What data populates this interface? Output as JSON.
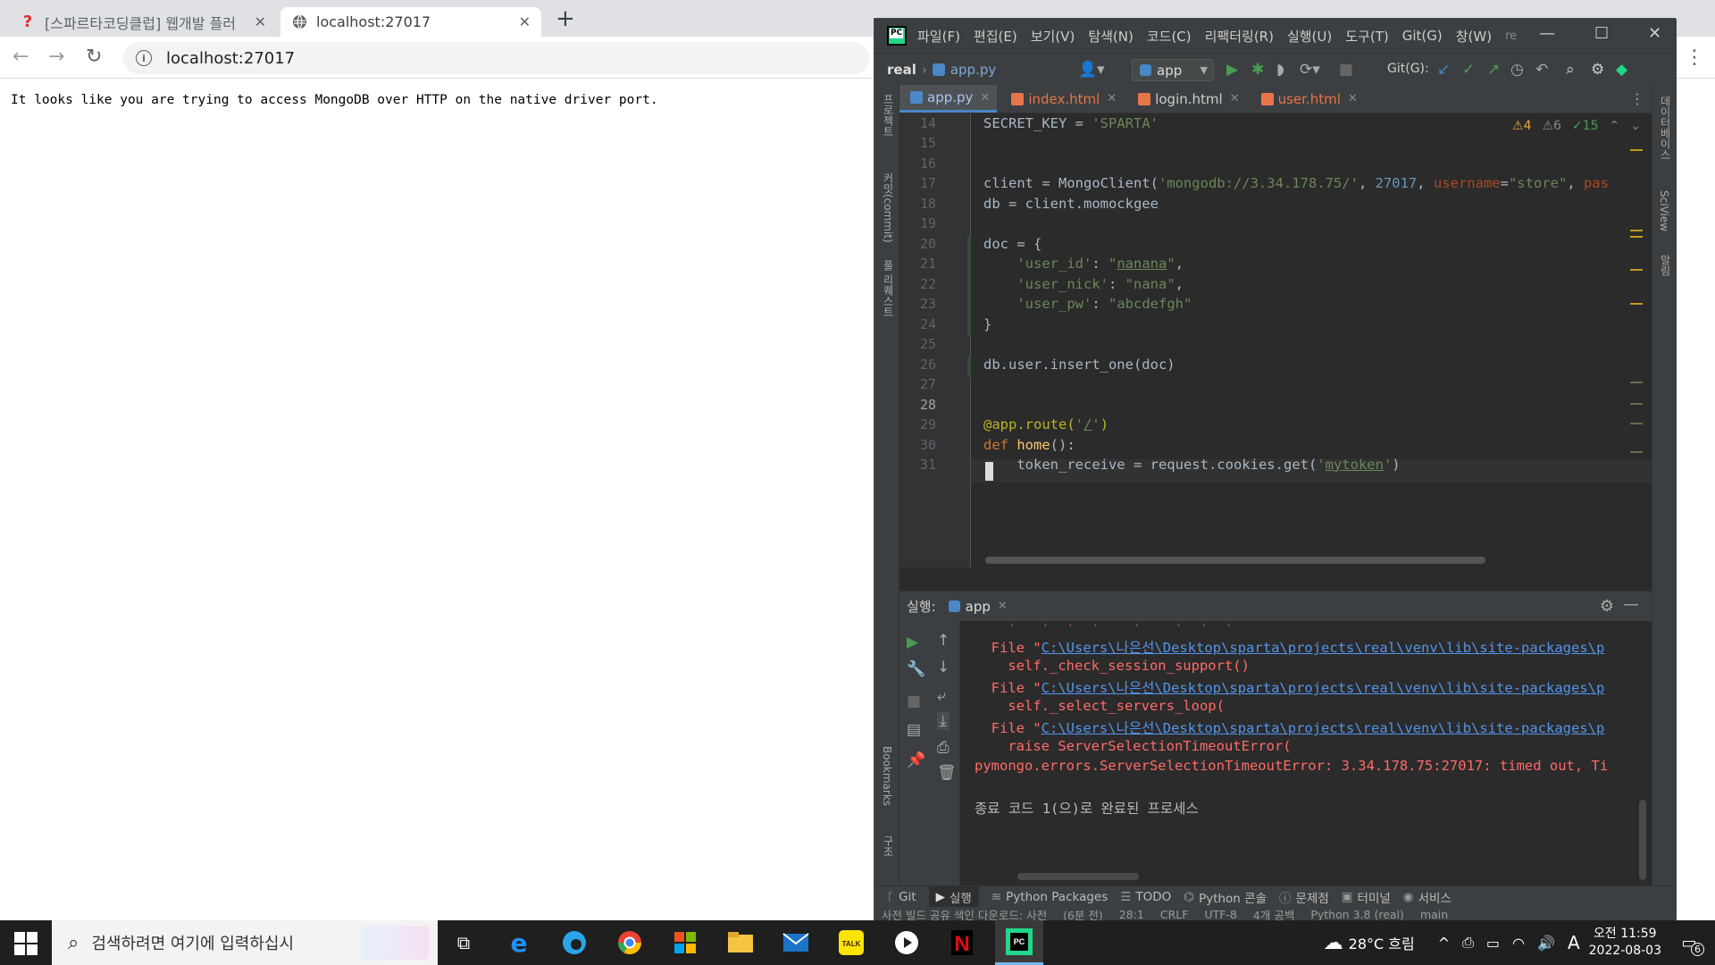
{
  "browser": {
    "tabs": [
      {
        "title": "[스파르타코딩클럽] 웹개발 플러",
        "active": false
      },
      {
        "title": "localhost:27017",
        "active": true
      }
    ],
    "address": "localhost:27017",
    "page_text": "It looks like you are trying to access MongoDB over HTTP on the native driver port."
  },
  "ide": {
    "menu": [
      "파일(F)",
      "편집(E)",
      "보기(V)",
      "탐색(N)",
      "코드(C)",
      "리팩터링(R)",
      "실행(U)",
      "도구(T)",
      "Git(G)",
      "창(W)",
      "re"
    ],
    "project": "real",
    "crumb_file": "app.py",
    "run_config": "app",
    "git_label": "Git(G):",
    "editor_tabs": [
      {
        "name": "app.py",
        "active": true,
        "color": "#4a88c7"
      },
      {
        "name": "index.html",
        "active": false,
        "color": "#e8754a"
      },
      {
        "name": "login.html",
        "active": false,
        "color": "#e8754a"
      },
      {
        "name": "user.html",
        "active": false,
        "color": "#e8754a"
      }
    ],
    "inspections": {
      "warnings": "4",
      "weak_warnings": "6",
      "ok": "15"
    },
    "line_numbers": [
      "14",
      "15",
      "16",
      "17",
      "18",
      "19",
      "20",
      "21",
      "22",
      "23",
      "24",
      "25",
      "26",
      "27",
      "28",
      "29",
      "30",
      "31"
    ],
    "current_line": "28",
    "left_panels": [
      "프로젝트",
      "커밋(commit)",
      "풀 리퀘스트",
      "Bookmarks",
      "구조"
    ],
    "right_panels": [
      "데이터베이스",
      "SciView",
      "알림"
    ],
    "run_panel": {
      "label": "실행:",
      "tab": "app",
      "lines": [
        {
          "kind": "file",
          "prefix": "  File \"",
          "link": "C:\\Users\\나은선\\Desktop\\sparta\\projects\\real\\venv\\lib\\site-packages\\p"
        },
        {
          "kind": "err",
          "text": "    self._check_session_support()"
        },
        {
          "kind": "file",
          "prefix": "  File \"",
          "link": "C:\\Users\\나은선\\Desktop\\sparta\\projects\\real\\venv\\lib\\site-packages\\p"
        },
        {
          "kind": "err",
          "text": "    self._select_servers_loop("
        },
        {
          "kind": "file",
          "prefix": "  File \"",
          "link": "C:\\Users\\나은선\\Desktop\\sparta\\projects\\real\\venv\\lib\\site-packages\\p"
        },
        {
          "kind": "err",
          "text": "    raise ServerSelectionTimeoutError("
        },
        {
          "kind": "err",
          "text": "pymongo.errors.ServerSelectionTimeoutError: 3.34.178.75:27017: timed out, Ti"
        },
        {
          "kind": "blank",
          "text": ""
        },
        {
          "kind": "gray",
          "text": "종료 코드 1(으)로 완료된 프로세스"
        }
      ]
    },
    "bottom_tabs": [
      "Git",
      "실행",
      "Python Packages",
      "TODO",
      "Python 콘솔",
      "문제점",
      "터미널",
      "서비스"
    ],
    "status": [
      "사전 빌드 공유 색인 다운로드: 사전",
      "(6분 전)",
      "28:1",
      "CRLF",
      "UTF-8",
      "4개 공백",
      "Python 3.8 (real)",
      "main"
    ]
  },
  "taskbar": {
    "search_placeholder": "검색하려면 여기에 입력하십시",
    "weather": "28°C 흐림",
    "ime": "A",
    "time": "오전 11:59",
    "date": "2022-08-03",
    "notifications": "6"
  }
}
